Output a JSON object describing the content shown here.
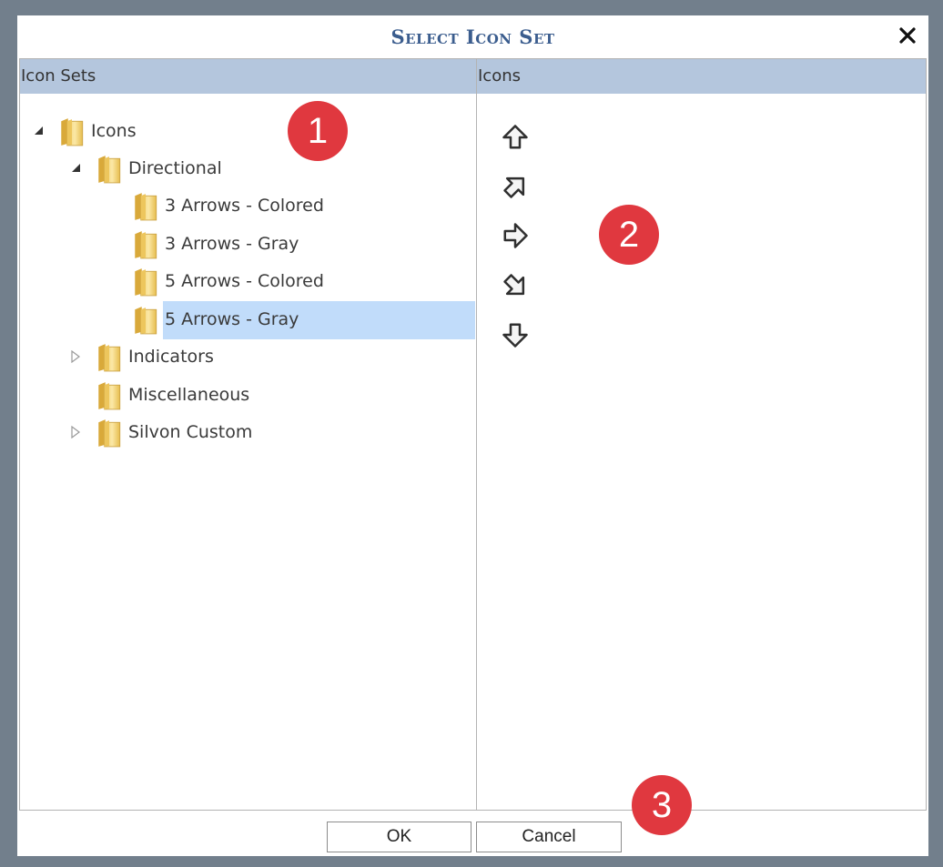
{
  "dialog": {
    "title": "Select Icon Set",
    "close_glyph": "✕"
  },
  "left_pane": {
    "header": "Icon Sets",
    "tree": [
      {
        "label": "Icons",
        "expanded": true,
        "selected": false
      },
      {
        "label": "Directional",
        "expanded": true,
        "selected": false
      },
      {
        "label": "3 Arrows - Colored",
        "selected": false
      },
      {
        "label": "3 Arrows - Gray",
        "selected": false
      },
      {
        "label": "5 Arrows - Colored",
        "selected": false
      },
      {
        "label": "5 Arrows - Gray",
        "selected": true
      },
      {
        "label": "Indicators",
        "expanded": false,
        "selected": false
      },
      {
        "label": "Miscellaneous",
        "selected": false
      },
      {
        "label": "Silvon Custom",
        "expanded": false,
        "selected": false
      }
    ]
  },
  "right_pane": {
    "header": "Icons",
    "icons": [
      "arrow-up-icon",
      "arrow-up-right-icon",
      "arrow-right-icon",
      "arrow-down-right-icon",
      "arrow-down-icon"
    ]
  },
  "buttons": {
    "ok_label": "OK",
    "cancel_label": "Cancel"
  },
  "annotations": [
    "1",
    "2",
    "3"
  ],
  "colors": {
    "backdrop": "#727f8c",
    "header_bg": "#b4c6dd",
    "title_text": "#3b5d8e",
    "selection": "#c1dcfa",
    "badge": "#e0383f"
  }
}
